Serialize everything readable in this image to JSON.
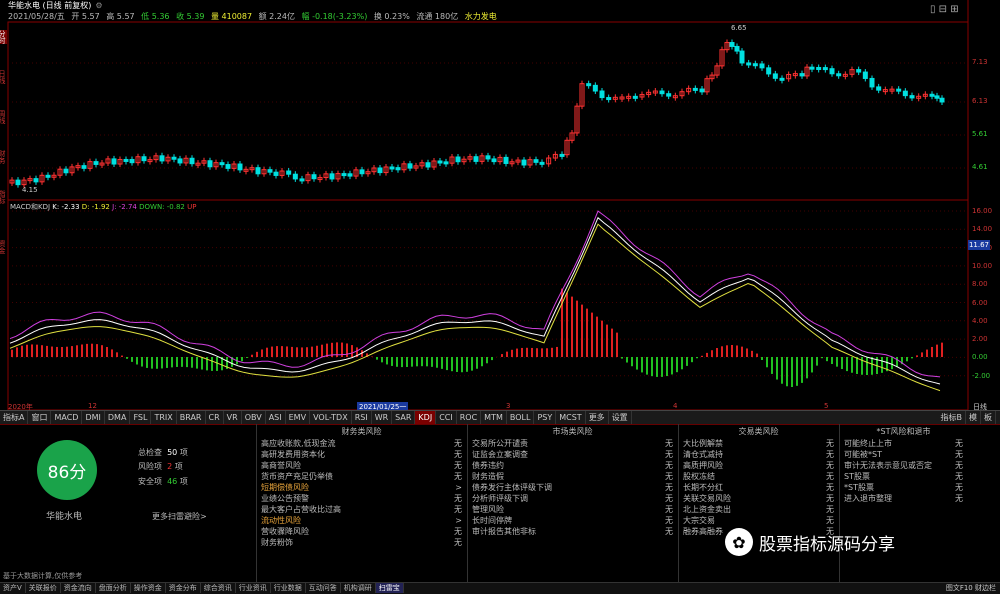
{
  "info_bar": {
    "title": "华能水电 (日线 前复权)",
    "date": "2021/05/28/五",
    "open": "开 5.57",
    "high": "高 5.57",
    "low": "低 5.36",
    "close": "收 5.39",
    "volume": "量 410087",
    "amount": "额 2.24亿",
    "change": "幅 -0.18(-3.23%)",
    "turnover": "换 0.23%",
    "float": "流通 180亿",
    "concept": "水力发电"
  },
  "left_tabs": [
    "分时",
    "日线",
    "周线",
    "财务",
    "指标",
    "资金"
  ],
  "price_axis": [
    "7.13",
    "6.13",
    "5.61",
    "4.61"
  ],
  "price_annotations": {
    "high_label": "6.65",
    "low_label": "4.15"
  },
  "indicator_bar": {
    "name": "MACD和KDJ",
    "k": "K: -2.33",
    "d": "D: -1.92",
    "j": "J: -2.74",
    "down": "DOWN: -0.82",
    "up": "UP"
  },
  "macd_axis": [
    "16.00",
    "14.00",
    "12.00",
    "10.00",
    "8.00",
    "6.00",
    "4.00",
    "2.00",
    "0.00",
    "-2.00"
  ],
  "macd_current": "11.67",
  "time_axis": [
    "2020年",
    "12",
    "2021/01/25一",
    "3",
    "4",
    "5"
  ],
  "time_axis_right": "日线",
  "tabs": [
    "指标A",
    "窗口",
    "MACD",
    "DMI",
    "DMA",
    "FSL",
    "TRIX",
    "BRAR",
    "CR",
    "VR",
    "OBV",
    "ASI",
    "EMV",
    "VOL-TDX",
    "RSI",
    "WR",
    "SAR",
    "KDJ",
    "CCI",
    "ROC",
    "MTM",
    "BOLL",
    "PSY",
    "MCST",
    "更多",
    "设置"
  ],
  "tabs_right": [
    "指标B",
    "模",
    "板"
  ],
  "risk_panel": {
    "score": "86分",
    "stock_name": "华能水电",
    "total_label": "总检查",
    "total_value": "50",
    "total_unit": "项",
    "risk_label": "风险项",
    "risk_value": "2",
    "risk_unit": "项",
    "safe_label": "安全项",
    "safe_value": "46",
    "safe_unit": "项",
    "more_link": "更多扫雷避险>",
    "note": "基于大数据计算,仅供参考",
    "columns": [
      {
        "title": "财务类风险",
        "rows": [
          {
            "name": "高应收账款,低现金流",
            "value": "无",
            "warn": false
          },
          {
            "name": "高研发费用资本化",
            "value": "无",
            "warn": false
          },
          {
            "name": "高商誉风险",
            "value": "无",
            "warn": false
          },
          {
            "name": "货币资产充足仍举债",
            "value": "无",
            "warn": false
          },
          {
            "name": "短期偿债风险",
            "value": ">",
            "warn": true
          },
          {
            "name": "业绩公告预警",
            "value": "无",
            "warn": false
          },
          {
            "name": "最大客户占营收比过高",
            "value": "无",
            "warn": false
          },
          {
            "name": "流动性风险",
            "value": ">",
            "warn": true
          },
          {
            "name": "营收骤降风险",
            "value": "无",
            "warn": false
          },
          {
            "name": "财务粉饰",
            "value": "无",
            "warn": false
          }
        ]
      },
      {
        "title": "市场类风险",
        "rows": [
          {
            "name": "交易所公开谴责",
            "value": "无",
            "warn": false
          },
          {
            "name": "证监会立案调查",
            "value": "无",
            "warn": false
          },
          {
            "name": "债券违约",
            "value": "无",
            "warn": false
          },
          {
            "name": "财务造假",
            "value": "无",
            "warn": false
          },
          {
            "name": "债券发行主体评级下调",
            "value": "无",
            "warn": false
          },
          {
            "name": "分析师评级下调",
            "value": "无",
            "warn": false
          },
          {
            "name": "管理风险",
            "value": "无",
            "warn": false
          },
          {
            "name": "长时间停牌",
            "value": "无",
            "warn": false
          },
          {
            "name": "审计报告其他非标",
            "value": "无",
            "warn": false
          }
        ]
      },
      {
        "title": "交易类风险",
        "rows": [
          {
            "name": "大比例解禁",
            "value": "无",
            "warn": false
          },
          {
            "name": "清仓式减持",
            "value": "无",
            "warn": false
          },
          {
            "name": "高质押风险",
            "value": "无",
            "warn": false
          },
          {
            "name": "股权冻结",
            "value": "无",
            "warn": false
          },
          {
            "name": "长期不分红",
            "value": "无",
            "warn": false
          },
          {
            "name": "关联交易风险",
            "value": "无",
            "warn": false
          },
          {
            "name": "北上资金卖出",
            "value": "无",
            "warn": false
          },
          {
            "name": "大宗交易",
            "value": "无",
            "warn": false
          },
          {
            "name": "融券高融券",
            "value": "无",
            "warn": false
          }
        ]
      },
      {
        "title": "*ST风险和退市",
        "rows": [
          {
            "name": "可能终止上市",
            "value": "无",
            "warn": false
          },
          {
            "name": "可能被*ST",
            "value": "无",
            "warn": false
          },
          {
            "name": "审计无法表示意见或否定",
            "value": "无",
            "warn": false
          },
          {
            "name": "ST股票",
            "value": "无",
            "warn": false
          },
          {
            "name": "*ST股票",
            "value": "无",
            "warn": false
          },
          {
            "name": "进入退市整理",
            "value": "无",
            "warn": false
          }
        ]
      }
    ]
  },
  "bottom_tabs": [
    "资产V",
    "关联报价",
    "资金流向",
    "盘面分析",
    "操作资金",
    "资金分布",
    "综合资讯",
    "行业资讯",
    "行业数据",
    "互动问答",
    "机构调研",
    "扫雷宝"
  ],
  "bottom_right": "图文F10 财边栏",
  "watermark": "股票指标源码分享",
  "colors": {
    "up": "#ff3232",
    "down": "#00e0e0",
    "macd_up": "#e02020",
    "macd_down": "#20c020",
    "k": "#ffffff",
    "d": "#e0e040",
    "j": "#d040e0"
  }
}
